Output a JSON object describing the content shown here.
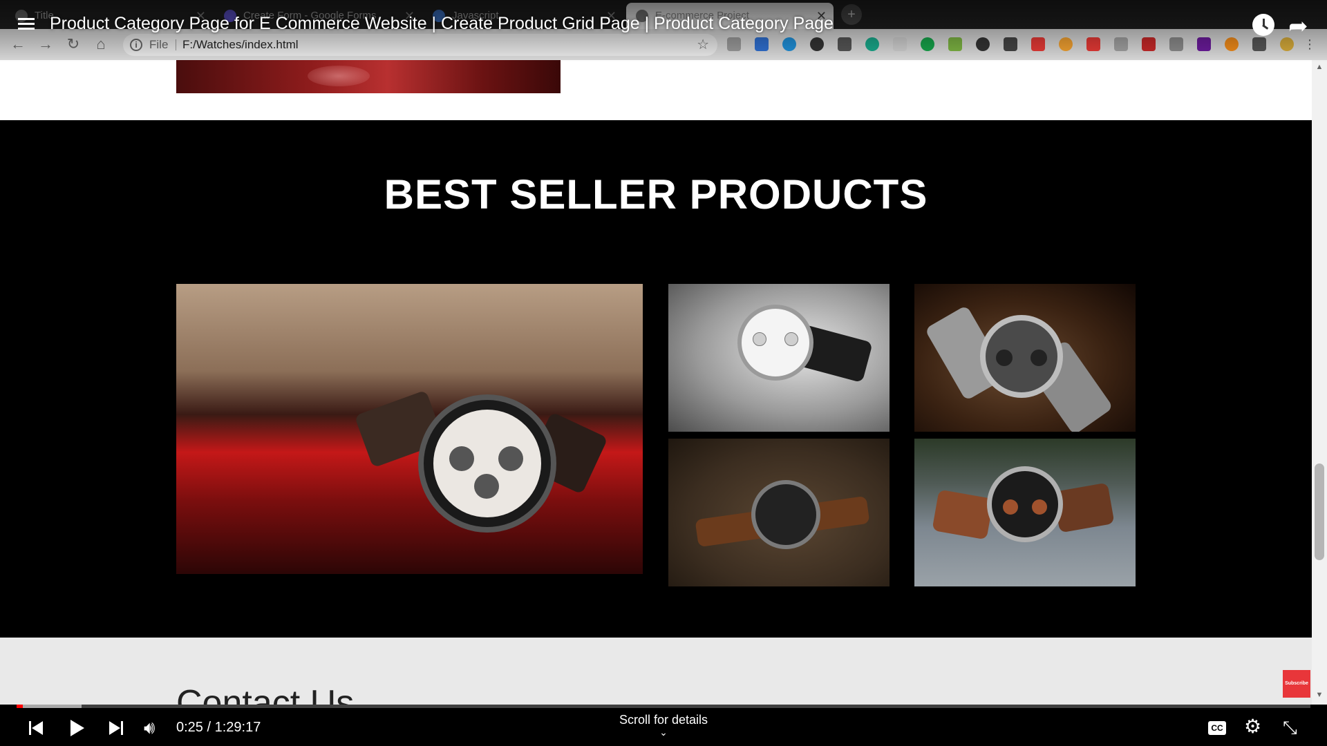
{
  "video": {
    "title": "Product Category Page for E Commerce Website | Create Product Grid Page | Product Category Page",
    "current_time": "0:25",
    "duration": "1:29:17",
    "progress_fraction": 0.0047,
    "loaded_fraction": 0.05,
    "scroll_hint": "Scroll for details",
    "cc_label": "CC",
    "watermark_label": "Subscribe"
  },
  "browser": {
    "tabs": [
      {
        "label": "Title",
        "active": false
      },
      {
        "label": "Create Form - Google Forms",
        "active": false
      },
      {
        "label": "Javascript",
        "active": false
      },
      {
        "label": "E-commerce Project",
        "active": true
      }
    ],
    "address": {
      "scheme_label": "File",
      "url": "F:/Watches/index.html"
    }
  },
  "page": {
    "section_title": "BEST SELLER PRODUCTS",
    "contact_heading": "Contact Us"
  },
  "icons": {
    "menu": "playlist-menu-icon",
    "watch_later": "clock-icon",
    "share": "share-arrow-icon",
    "previous": "skip-previous-icon",
    "play": "play-icon",
    "next": "skip-next-icon",
    "volume": "volume-icon",
    "settings": "gear-icon",
    "exit_fullscreen": "exit-fullscreen-icon"
  },
  "colors": {
    "progress_played": "#ff0000",
    "page_section_bg": "#000000",
    "subscribe_badge": "#e8363a"
  }
}
